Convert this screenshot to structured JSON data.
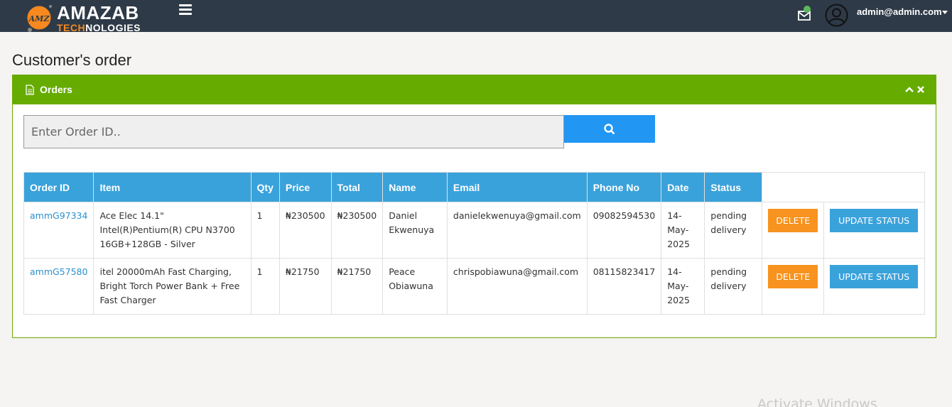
{
  "brand": {
    "word1": "AMAZAB",
    "word2_orange": "TECH",
    "word2_white": "NOLOGIES",
    "badge_text": "AMZ"
  },
  "header": {
    "user_email": "admin@admin.com"
  },
  "page": {
    "title": "Customer's order"
  },
  "panel": {
    "title": "Orders"
  },
  "search": {
    "placeholder": "Enter Order ID.."
  },
  "table": {
    "headers": [
      "Order ID",
      "Item",
      "Qty",
      "Price",
      "Total",
      "Name",
      "Email",
      "Phone No",
      "Date",
      "Status"
    ],
    "rows": [
      {
        "order_id": "ammG97334",
        "item": "Ace Elec 14.1\" Intel(R)Pentium(R) CPU N3700 16GB+128GB - Silver",
        "qty": "1",
        "price": "₦230500",
        "total": "₦230500",
        "name": "Daniel Ekwenuya",
        "email": "danielekwenuya@gmail.com",
        "phone": "09082594530",
        "date": "14-May-2025",
        "status": "pending delivery",
        "delete_label": "DELETE",
        "update_label": "UPDATE STATUS"
      },
      {
        "order_id": "ammG57580",
        "item": "itel 20000mAh Fast Charging, Bright Torch Power Bank + Free Fast Charger",
        "qty": "1",
        "price": "₦21750",
        "total": "₦21750",
        "name": "Peace Obiawuna",
        "email": "chrispobiawuna@gmail.com",
        "phone": "08115823417",
        "date": "14-May-2025",
        "status": "pending delivery",
        "delete_label": "DELETE",
        "update_label": "UPDATE STATUS"
      }
    ]
  },
  "watermark": "Activate Windows",
  "colors": {
    "topbar": "#2e3a47",
    "panel_green": "#66ab00",
    "header_blue": "#3aa2db",
    "search_blue": "#2196f3",
    "delete_orange": "#f7931e",
    "brand_orange": "#f7891f"
  }
}
